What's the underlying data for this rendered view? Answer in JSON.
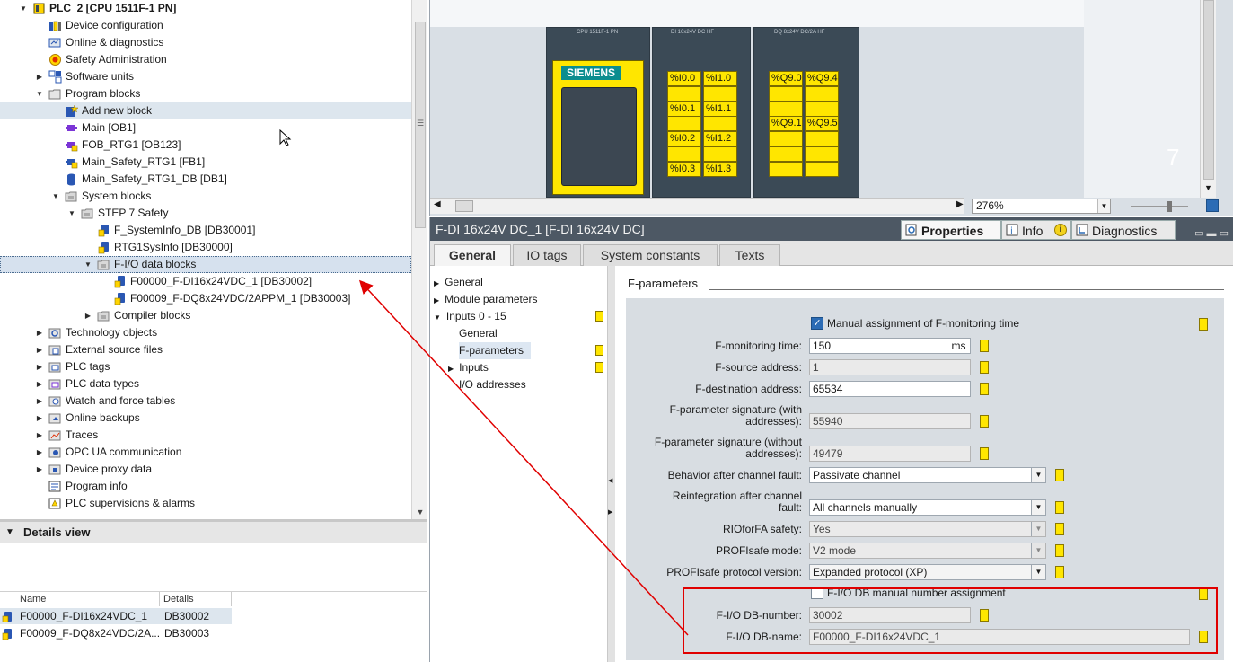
{
  "tree": {
    "items": [
      {
        "label": "PLC_2 [CPU 1511F-1 PN]",
        "arrow": "open",
        "indent": 0,
        "icon": "plc-icon",
        "bold": true
      },
      {
        "label": "Device configuration",
        "arrow": "",
        "indent": 1,
        "icon": "device-config-icon"
      },
      {
        "label": "Online & diagnostics",
        "arrow": "",
        "indent": 1,
        "icon": "online-diagnostics-icon"
      },
      {
        "label": "Safety Administration",
        "arrow": "",
        "indent": 1,
        "icon": "safety-admin-icon"
      },
      {
        "label": "Software units",
        "arrow": "closed",
        "indent": 1,
        "icon": "software-units-icon"
      },
      {
        "label": "Program blocks",
        "arrow": "open",
        "indent": 1,
        "icon": "folder-icon"
      },
      {
        "label": "Add new block",
        "arrow": "",
        "indent": 2,
        "icon": "add-block-icon"
      },
      {
        "label": "Main [OB1]",
        "arrow": "",
        "indent": 2,
        "icon": "ob-block-icon"
      },
      {
        "label": "FOB_RTG1 [OB123]",
        "arrow": "",
        "indent": 2,
        "icon": "f-ob-block-icon"
      },
      {
        "label": "Main_Safety_RTG1 [FB1]",
        "arrow": "",
        "indent": 2,
        "icon": "f-fb-block-icon"
      },
      {
        "label": "Main_Safety_RTG1_DB [DB1]",
        "arrow": "",
        "indent": 2,
        "icon": "db-block-icon"
      },
      {
        "label": "System blocks",
        "arrow": "open",
        "indent": 2,
        "icon": "system-folder-icon"
      },
      {
        "label": "STEP 7 Safety",
        "arrow": "open",
        "indent": 3,
        "icon": "system-folder-icon"
      },
      {
        "label": "F_SystemInfo_DB [DB30001]",
        "arrow": "",
        "indent": 4,
        "icon": "f-db-block-icon"
      },
      {
        "label": "RTG1SysInfo [DB30000]",
        "arrow": "",
        "indent": 4,
        "icon": "f-db-block-icon"
      },
      {
        "label": "F-I/O data blocks",
        "arrow": "open",
        "indent": 4,
        "icon": "system-folder-icon"
      },
      {
        "label": "F00000_F-DI16x24VDC_1 [DB30002]",
        "arrow": "",
        "indent": 5,
        "icon": "f-db-block-icon"
      },
      {
        "label": "F00009_F-DQ8x24VDC/2APPM_1 [DB30003]",
        "arrow": "",
        "indent": 5,
        "icon": "f-db-block-icon"
      },
      {
        "label": "Compiler blocks",
        "arrow": "closed",
        "indent": 4,
        "icon": "system-folder-icon"
      },
      {
        "label": "Technology objects",
        "arrow": "closed",
        "indent": 1,
        "icon": "technology-objects-icon"
      },
      {
        "label": "External source files",
        "arrow": "closed",
        "indent": 1,
        "icon": "external-source-icon"
      },
      {
        "label": "PLC tags",
        "arrow": "closed",
        "indent": 1,
        "icon": "plc-tags-icon"
      },
      {
        "label": "PLC data types",
        "arrow": "closed",
        "indent": 1,
        "icon": "plc-data-types-icon"
      },
      {
        "label": "Watch and force tables",
        "arrow": "closed",
        "indent": 1,
        "icon": "watch-table-icon"
      },
      {
        "label": "Online backups",
        "arrow": "closed",
        "indent": 1,
        "icon": "online-backups-icon"
      },
      {
        "label": "Traces",
        "arrow": "closed",
        "indent": 1,
        "icon": "traces-icon"
      },
      {
        "label": "OPC UA communication",
        "arrow": "closed",
        "indent": 1,
        "icon": "opc-ua-icon"
      },
      {
        "label": "Device proxy data",
        "arrow": "closed",
        "indent": 1,
        "icon": "device-proxy-icon"
      },
      {
        "label": "Program info",
        "arrow": "",
        "indent": 1,
        "icon": "program-info-icon"
      },
      {
        "label": "PLC supervisions & alarms",
        "arrow": "",
        "indent": 1,
        "icon": "plc-alarms-icon"
      }
    ]
  },
  "details": {
    "title": "Details view",
    "columns": [
      "Name",
      "Details"
    ],
    "rows": [
      {
        "name": "F00000_F-DI16x24VDC_1",
        "details": "DB30002"
      },
      {
        "name": "F00009_F-DQ8x24VDC/2A...",
        "details": "DB30003"
      }
    ]
  },
  "device": {
    "brand": "SIEMENS",
    "modules": [
      "CPU 1511F-1 PN",
      "DI 16x24V DC HF",
      "DQ 8x24V DC/2A HF"
    ],
    "di_slots": [
      [
        "%I0.0",
        "%I1.0"
      ],
      [
        "",
        ""
      ],
      [
        "%I0.1",
        "%I1.1"
      ],
      [
        "",
        ""
      ],
      [
        "%I0.2",
        "%I1.2"
      ],
      [
        "",
        ""
      ],
      [
        "%I0.3",
        "%I1.3"
      ]
    ],
    "dq_slots": [
      [
        "%Q9.0",
        "%Q9.4"
      ],
      [
        "",
        ""
      ],
      [
        "",
        ""
      ],
      [
        "%Q9.1",
        "%Q9.5"
      ],
      [
        "",
        ""
      ],
      [
        "",
        ""
      ],
      [
        "",
        ""
      ]
    ],
    "zoom": "276%"
  },
  "props": {
    "title": "F-DI 16x24V DC_1 [F-DI 16x24V DC]",
    "top_tabs": {
      "properties": "Properties",
      "info": "Info",
      "diagnostics": "Diagnostics"
    },
    "tabs": [
      "General",
      "IO tags",
      "System constants",
      "Texts"
    ],
    "nav": [
      {
        "label": "General",
        "arrow": "closed",
        "indent": 0,
        "mark": false
      },
      {
        "label": "Module parameters",
        "arrow": "closed",
        "indent": 0,
        "mark": false
      },
      {
        "label": "Inputs 0 - 15",
        "arrow": "open",
        "indent": 0,
        "mark": true
      },
      {
        "label": "General",
        "arrow": "",
        "indent": 1,
        "mark": false
      },
      {
        "label": "F-parameters",
        "arrow": "",
        "indent": 1,
        "mark": true
      },
      {
        "label": "Inputs",
        "arrow": "closed",
        "indent": 1,
        "mark": true
      },
      {
        "label": "I/O addresses",
        "arrow": "",
        "indent": 1,
        "mark": false
      }
    ],
    "section_title": "F-parameters",
    "manual_monitoring_label": "Manual assignment of F-monitoring time",
    "fields": {
      "monitoring_time": {
        "label": "F-monitoring time:",
        "value": "150",
        "unit": "ms"
      },
      "source_address": {
        "label": "F-source address:",
        "value": "1"
      },
      "destination_address": {
        "label": "F-destination address:",
        "value": "65534"
      },
      "sig_with": {
        "label": "F-parameter signature (with addresses):",
        "value": "55940"
      },
      "sig_without": {
        "label": "F-parameter signature (without addresses):",
        "value": "49479"
      },
      "channel_fault": {
        "label": "Behavior after channel fault:",
        "value": "Passivate channel"
      },
      "reintegration": {
        "label": "Reintegration after channel fault:",
        "value": "All channels manually"
      },
      "rioforfa": {
        "label": "RIOforFA safety:",
        "value": "Yes"
      },
      "profisafe_mode": {
        "label": "PROFIsafe mode:",
        "value": "V2 mode"
      },
      "protocol_version": {
        "label": "PROFIsafe protocol version:",
        "value": "Expanded protocol (XP)"
      },
      "db_manual_label": "F-I/O DB manual number assignment",
      "db_number": {
        "label": "F-I/O DB-number:",
        "value": "30002"
      },
      "db_name": {
        "label": "F-I/O DB-name:",
        "value": "F00000_F-DI16x24VDC_1"
      }
    }
  },
  "colors": {
    "accent": "#ffe600",
    "highlight": "#e00000",
    "title_bar": "#4d5864"
  }
}
